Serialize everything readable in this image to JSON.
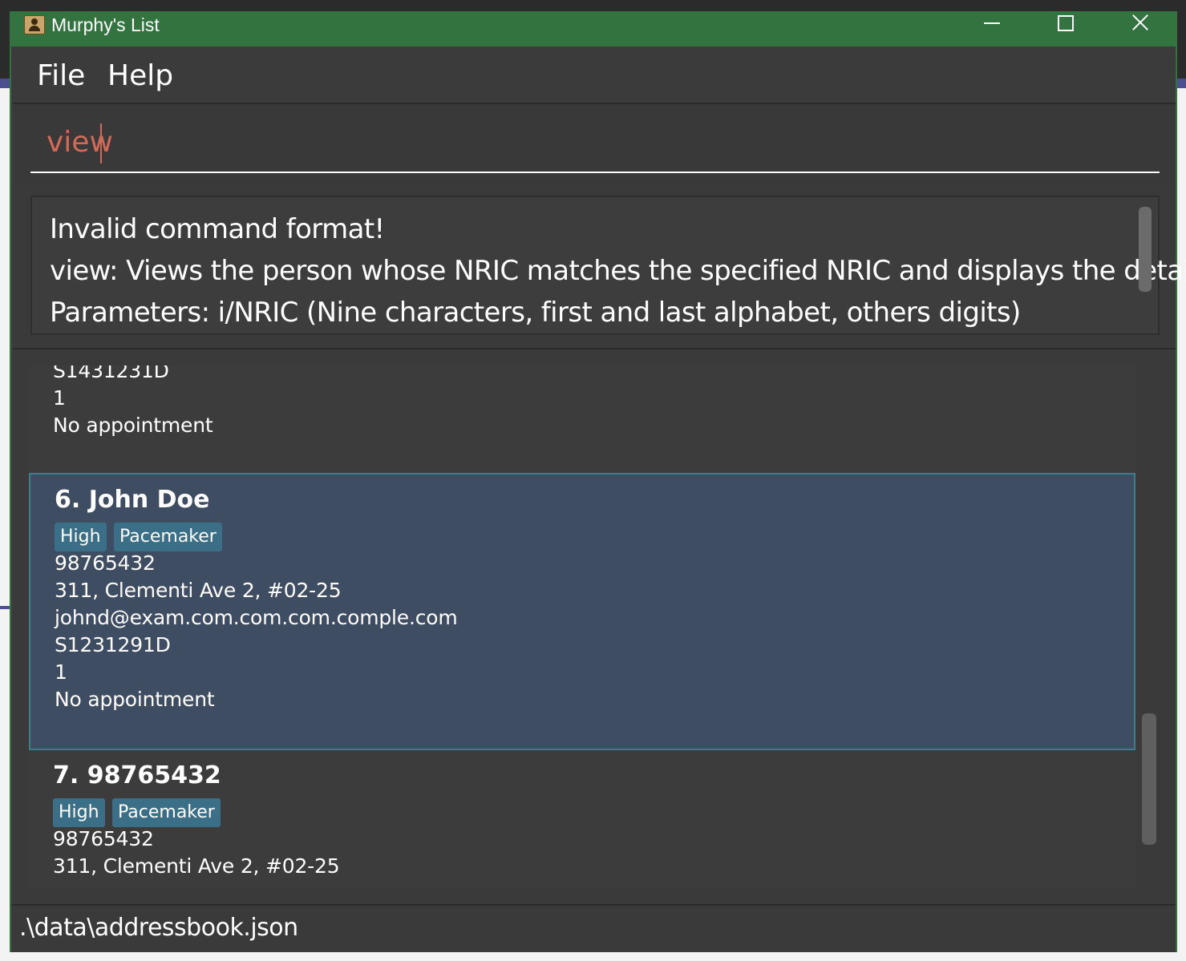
{
  "window": {
    "title": "Murphy's List"
  },
  "menu": {
    "file": "File",
    "help": "Help"
  },
  "command": {
    "value": "view"
  },
  "result": {
    "lines": [
      "Invalid command format!",
      "view: Views the person whose NRIC matches the specified NRIC and displays the details.",
      "Parameters: i/NRIC (Nine characters, first and last alphabet, others digits)"
    ]
  },
  "persons": {
    "partial_top": {
      "nric": "S1431231D",
      "ward": "1",
      "appointment": "No appointment"
    },
    "john": {
      "name": "6. John Doe",
      "tags": [
        "High",
        "Pacemaker"
      ],
      "phone": "98765432",
      "address": "311, Clementi Ave 2, #02-25",
      "email": "johnd@exam.com.com.com.comple.com",
      "nric": "S1231291D",
      "ward": "1",
      "appointment": "No appointment"
    },
    "seventh": {
      "name": "7. 98765432",
      "tags": [
        "High",
        "Pacemaker"
      ],
      "phone": "98765432",
      "address": "311, Clementi Ave 2, #02-25"
    }
  },
  "status": {
    "path": ".\\data\\addressbook.json"
  }
}
